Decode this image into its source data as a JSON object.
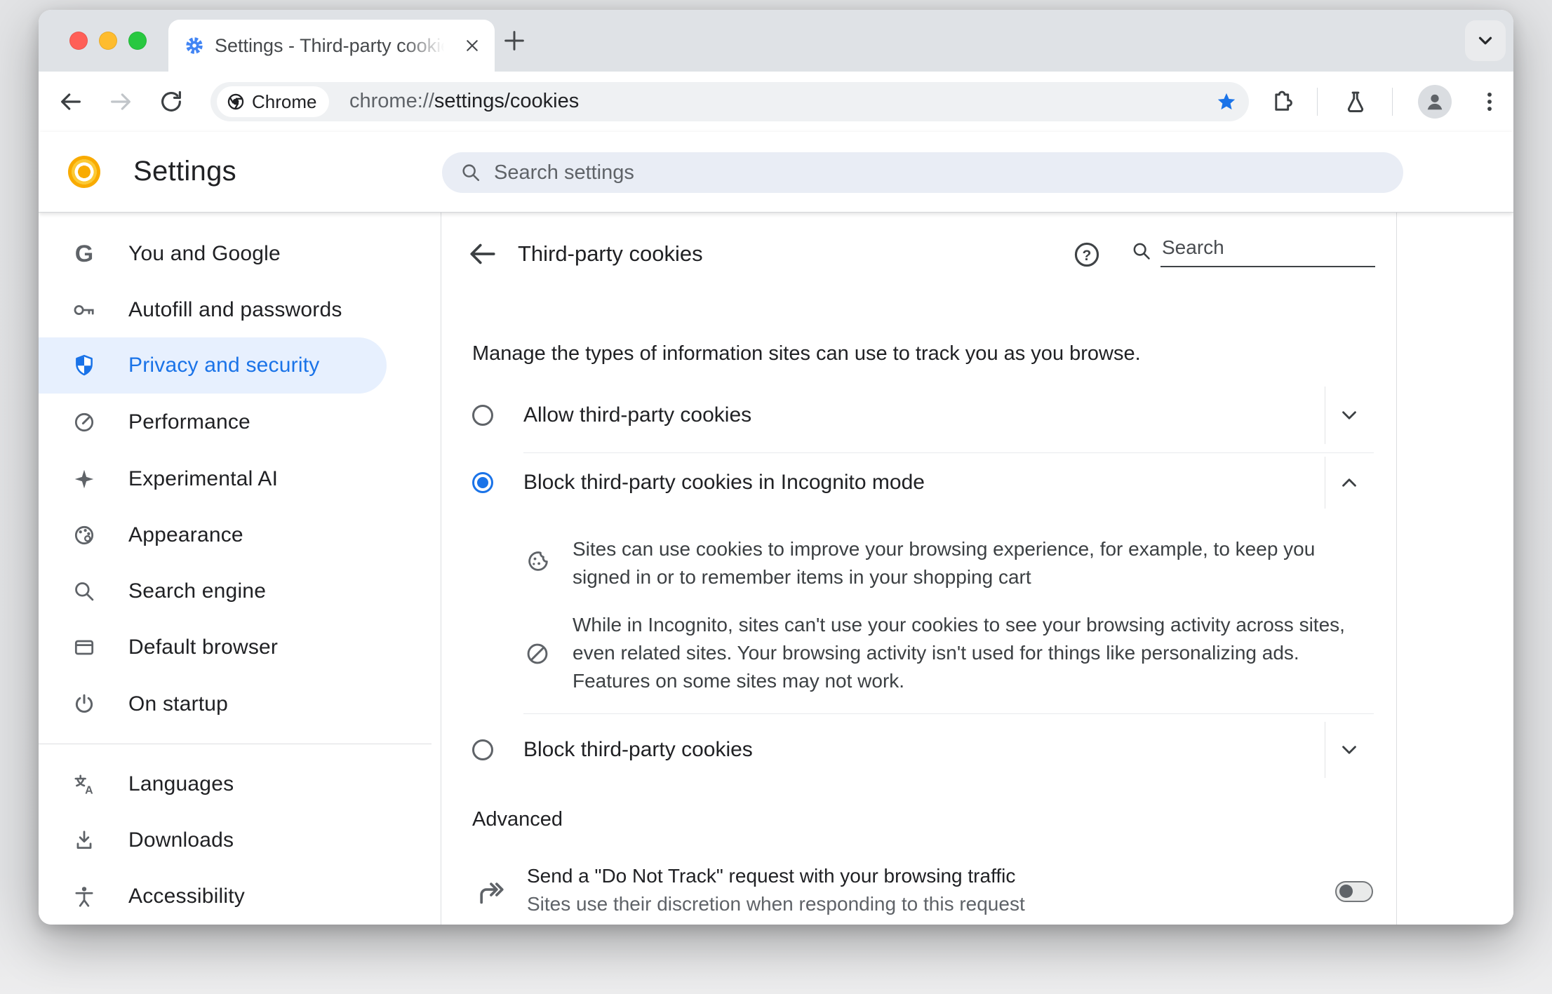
{
  "window": {
    "tab": {
      "title": "Settings - Third-party cookies"
    },
    "toolbar": {
      "chip_label": "Chrome",
      "url_protocol": "chrome://",
      "url_path": "settings/cookies"
    }
  },
  "settings_header": {
    "title": "Settings",
    "search_placeholder": "Search settings"
  },
  "sidebar": {
    "items": [
      {
        "label": "You and Google",
        "icon": "google-g-icon",
        "selected": false
      },
      {
        "label": "Autofill and passwords",
        "icon": "key-icon",
        "selected": false
      },
      {
        "label": "Privacy and security",
        "icon": "shield-icon",
        "selected": true
      },
      {
        "label": "Performance",
        "icon": "speedometer-icon",
        "selected": false
      },
      {
        "label": "Experimental AI",
        "icon": "sparkle-icon",
        "selected": false
      },
      {
        "label": "Appearance",
        "icon": "palette-icon",
        "selected": false
      },
      {
        "label": "Search engine",
        "icon": "search-icon",
        "selected": false
      },
      {
        "label": "Default browser",
        "icon": "browser-window-icon",
        "selected": false
      },
      {
        "label": "On startup",
        "icon": "power-icon",
        "selected": false
      },
      {
        "label": "Languages",
        "icon": "translate-icon",
        "selected": false
      },
      {
        "label": "Downloads",
        "icon": "download-icon",
        "selected": false
      },
      {
        "label": "Accessibility",
        "icon": "accessibility-icon",
        "selected": false
      }
    ]
  },
  "page": {
    "title": "Third-party cookies",
    "search_placeholder": "Search",
    "intro": "Manage the types of information sites can use to track you as you browse.",
    "options": [
      {
        "label": "Allow third-party cookies",
        "selected": false,
        "expanded": false
      },
      {
        "label": "Block third-party cookies in Incognito mode",
        "selected": true,
        "expanded": true,
        "details": [
          {
            "icon": "cookie-icon",
            "text": "Sites can use cookies to improve your browsing experience, for example, to keep you signed in or to remember items in your shopping cart"
          },
          {
            "icon": "blocked-icon",
            "text": "While in Incognito, sites can't use your cookies to see your browsing activity across sites, even related sites. Your browsing activity isn't used for things like personalizing ads. Features on some sites may not work."
          }
        ]
      },
      {
        "label": "Block third-party cookies",
        "selected": false,
        "expanded": false
      }
    ],
    "advanced_label": "Advanced",
    "dnt": {
      "title": "Send a \"Do Not Track\" request with your browsing traffic",
      "subtitle": "Sites use their discretion when responding to this request",
      "toggle_on": false
    }
  },
  "colors": {
    "accent": "#1a73e8",
    "selected_item_bg": "#e7f0fe",
    "bookmark_star": "#1a73e8",
    "favicon_gear": "#4285f4"
  }
}
